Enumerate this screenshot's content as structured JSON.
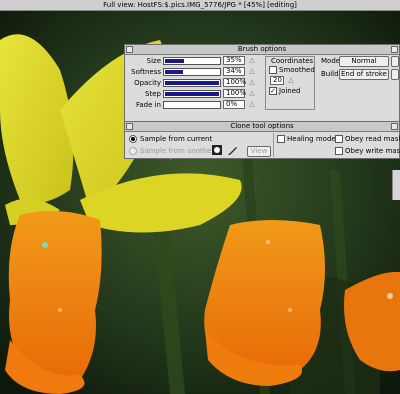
{
  "window": {
    "title": "Full view: HostFS:$.pics.IMG_5776/JPG * [45%] [editing]"
  },
  "brush_panel": {
    "title": "Brush options",
    "rows": [
      {
        "label": "Size",
        "value": "35%",
        "fill": 0.35
      },
      {
        "label": "Softness",
        "value": "34%",
        "fill": 0.34
      },
      {
        "label": "Opacity",
        "value": "100%",
        "fill": 1.0
      },
      {
        "label": "Step",
        "value": "100%",
        "fill": 1.0
      },
      {
        "label": "Fade in",
        "value": "0%",
        "fill": 0.0
      }
    ],
    "coordinates": {
      "title": "Coordinates",
      "smoothed_label": "Smoothed",
      "smoothed_checked": false,
      "smooth_value": "20",
      "joined_label": "Joined",
      "joined_checked": true
    },
    "mode_label": "Mode",
    "mode_value": "Normal",
    "build_label": "Build",
    "build_value": "End of stroke"
  },
  "clone_panel": {
    "title": "Clone tool options",
    "sample_current": "Sample from current",
    "sample_another": "Sample from another",
    "view_button": "View",
    "healing_mode": "Healing mode",
    "obey_read_mask": "Obey read mask",
    "obey_write_mask": "Obey write mask"
  },
  "colors": {
    "accent_fill": "#1a1a8c",
    "panel_bg": "#dcdcdc"
  },
  "icons": [
    "close-icon",
    "toggle-size-icon",
    "arrow-up-icon",
    "arrow-down-icon",
    "clone-source-icon",
    "pen-icon"
  ]
}
